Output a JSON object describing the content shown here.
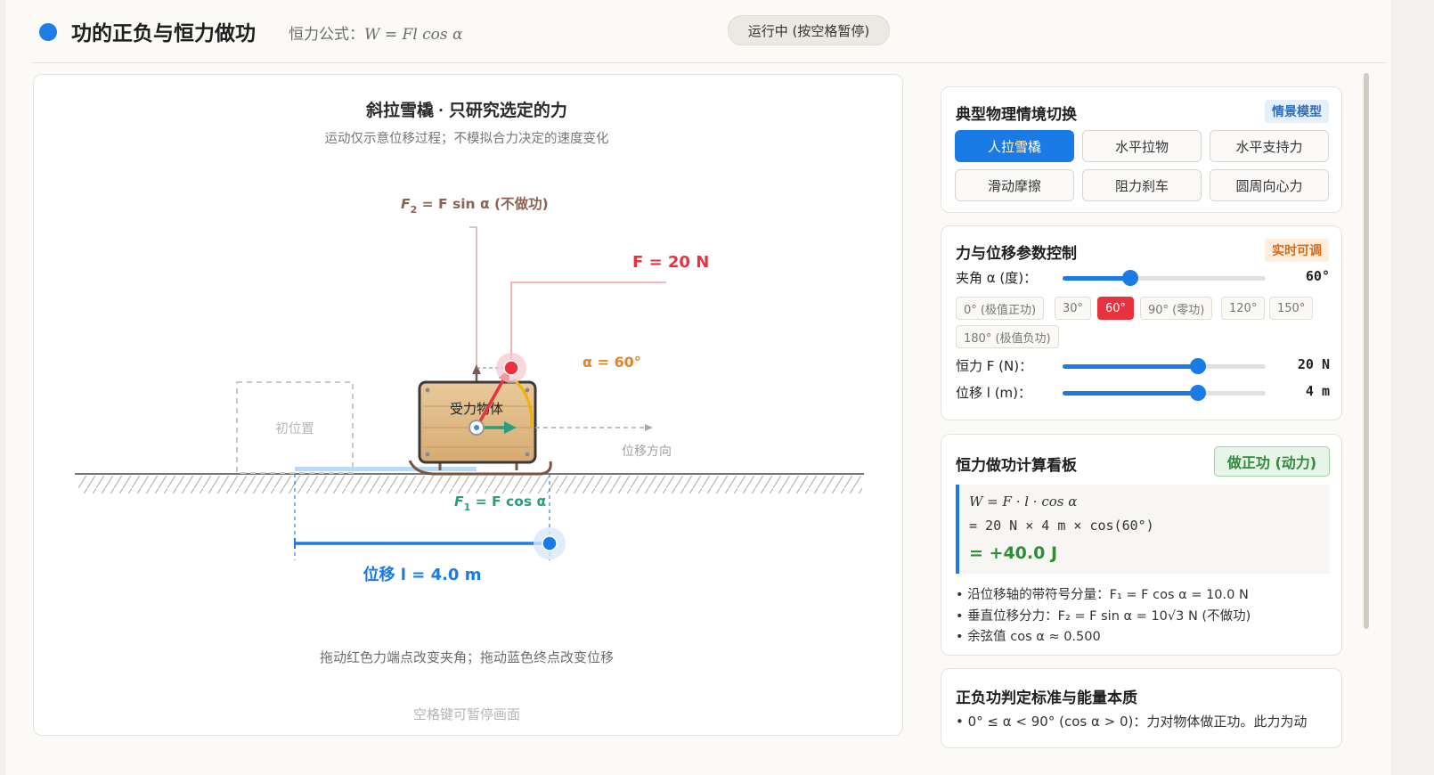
{
  "header": {
    "title": "功的正负与恒力做功",
    "formula_label": "恒力公式：",
    "formula": "W = Fl cos α",
    "run_button": "运行中 (按空格暂停)"
  },
  "sim": {
    "title": "斜拉雪橇 · 只研究选定的力",
    "subtitle": "运动仅示意位移过程；不模拟合力决定的速度变化",
    "f2_label_sym": "F",
    "f2_label_sub": "2",
    "f2_label_rest": " = F sin α (不做功)",
    "f_label": "F = 20 N",
    "angle_label": "α = 60°",
    "object_label": "受力物体",
    "initial_label": "初位置",
    "direction_label": "位移方向",
    "f1_label_sym": "F",
    "f1_label_sub": "1",
    "f1_label_rest": " = F cos α",
    "displacement_label": "位移 l = 4.0 m",
    "hint": "拖动红色力端点改变夹角；拖动蓝色终点改变位移",
    "pause_hint": "空格键可暂停画面"
  },
  "scene_panel": {
    "title": "典型物理情境切换",
    "tag": "情景模型",
    "buttons": [
      "人拉雪橇",
      "水平拉物",
      "水平支持力",
      "滑动摩擦",
      "阻力刹车",
      "圆周向心力"
    ],
    "active_index": 0
  },
  "param_panel": {
    "title": "力与位移参数控制",
    "tag": "实时可调",
    "angle": {
      "label": "夹角 α (度)：",
      "value_text": "60°",
      "value": 60,
      "min": 0,
      "max": 180
    },
    "angle_presets": [
      "0° (极值正功)",
      "30°",
      "60°",
      "90° (零功)",
      "120°",
      "150°",
      "180° (极值负功)"
    ],
    "active_preset": 2,
    "force": {
      "label": "恒力 F (N)：",
      "value_text": "20 N",
      "value": 20,
      "min": 0,
      "max": 30
    },
    "displacement": {
      "label": "位移 l (m)：",
      "value_text": "4 m",
      "value": 4,
      "min": 0,
      "max": 6
    }
  },
  "calc_panel": {
    "title": "恒力做功计算看板",
    "badge": "做正功 (动力)",
    "line1": "W = F · l · cos α",
    "line2": "= 20 N × 4 m × cos(60°)",
    "line3": "= +40.0 J",
    "bullets": [
      "• 沿位移轴的带符号分量：F₁ = F cos α = 10.0 N",
      "• 垂直位移分力：F₂ = F sin α = 10√3 N (不做功)",
      "• 余弦值 cos α ≈ 0.500"
    ]
  },
  "criteria_panel": {
    "title": "正负功判定标准与能量本质",
    "line1": "• 0° ≤ α < 90° (cos α > 0)：力对物体做正功。此力为动"
  },
  "colors": {
    "accent": "#1a7ae6",
    "force": "#e8323f",
    "component": "#2a9d7f",
    "angle": "#e0862a",
    "positive": "#2e8c3a"
  }
}
